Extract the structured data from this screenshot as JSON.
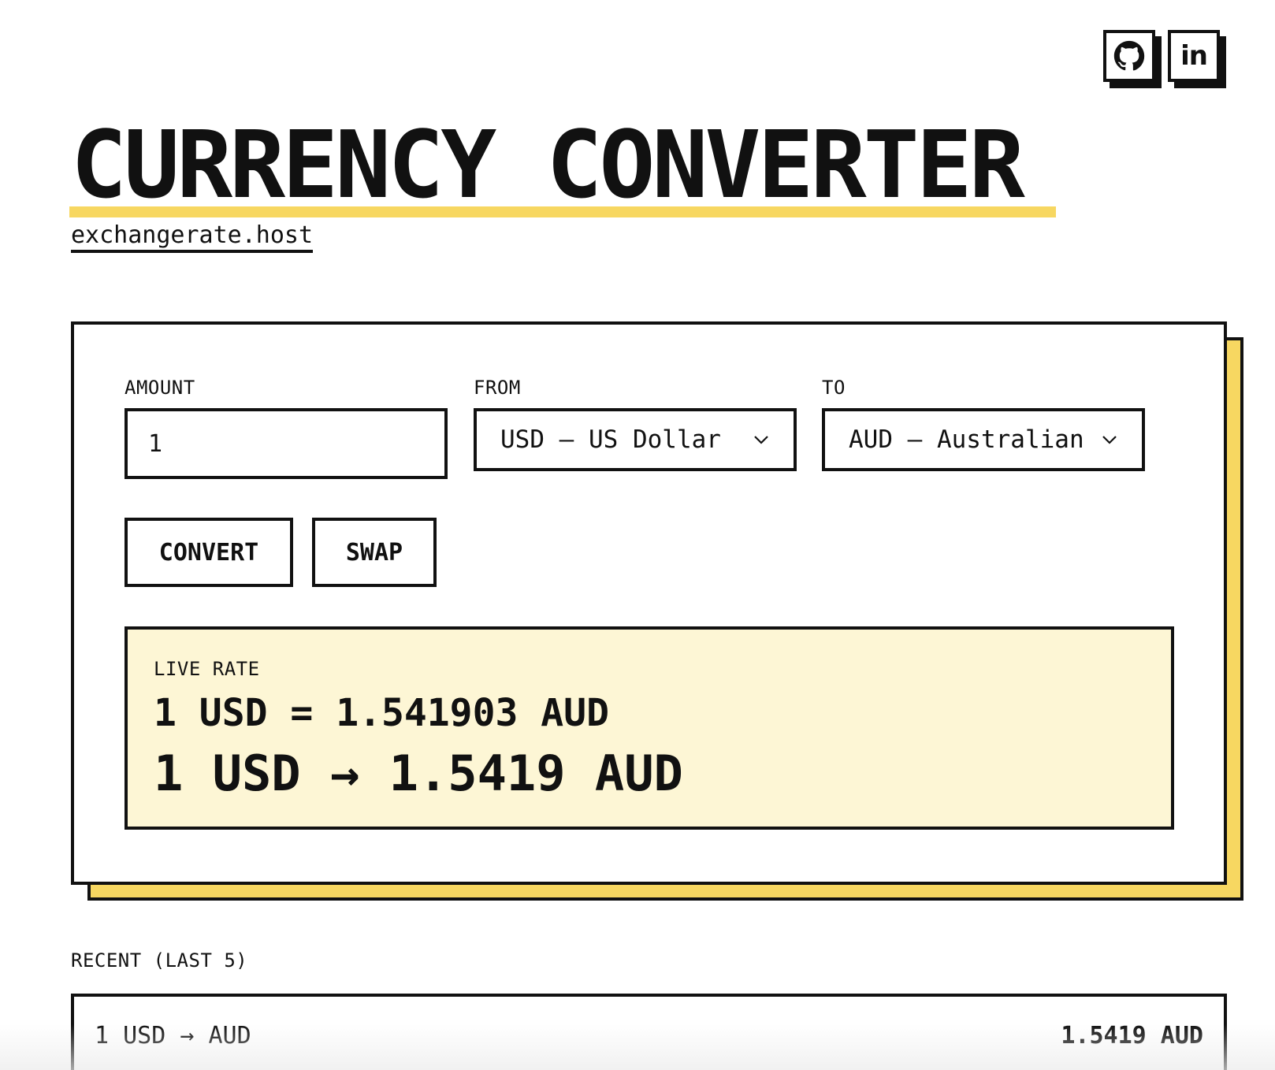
{
  "social": {
    "github": {
      "icon": "github-icon"
    },
    "linkedin": {
      "icon": "linkedin-icon",
      "glyph": "in"
    }
  },
  "header": {
    "title": "CURRENCY CONVERTER",
    "subtitle": "exchangerate.host"
  },
  "converter": {
    "amount_label": "AMOUNT",
    "amount_value": "1",
    "from_label": "FROM",
    "from_value": "USD — US Dollar",
    "to_label": "TO",
    "to_value": "AUD — Australian Dollar",
    "convert_label": "CONVERT",
    "swap_label": "SWAP"
  },
  "result": {
    "label": "LIVE RATE",
    "rate_text": "1 USD = 1.541903 AUD",
    "converted_text": "1 USD → 1.5419 AUD"
  },
  "recent": {
    "label": "RECENT (LAST 5)",
    "items": [
      {
        "pair": "1 USD → AUD",
        "value": "1.5419 AUD"
      }
    ]
  },
  "colors": {
    "accent": "#f7d761",
    "result_bg": "#fdf6d5",
    "ink": "#111111"
  }
}
